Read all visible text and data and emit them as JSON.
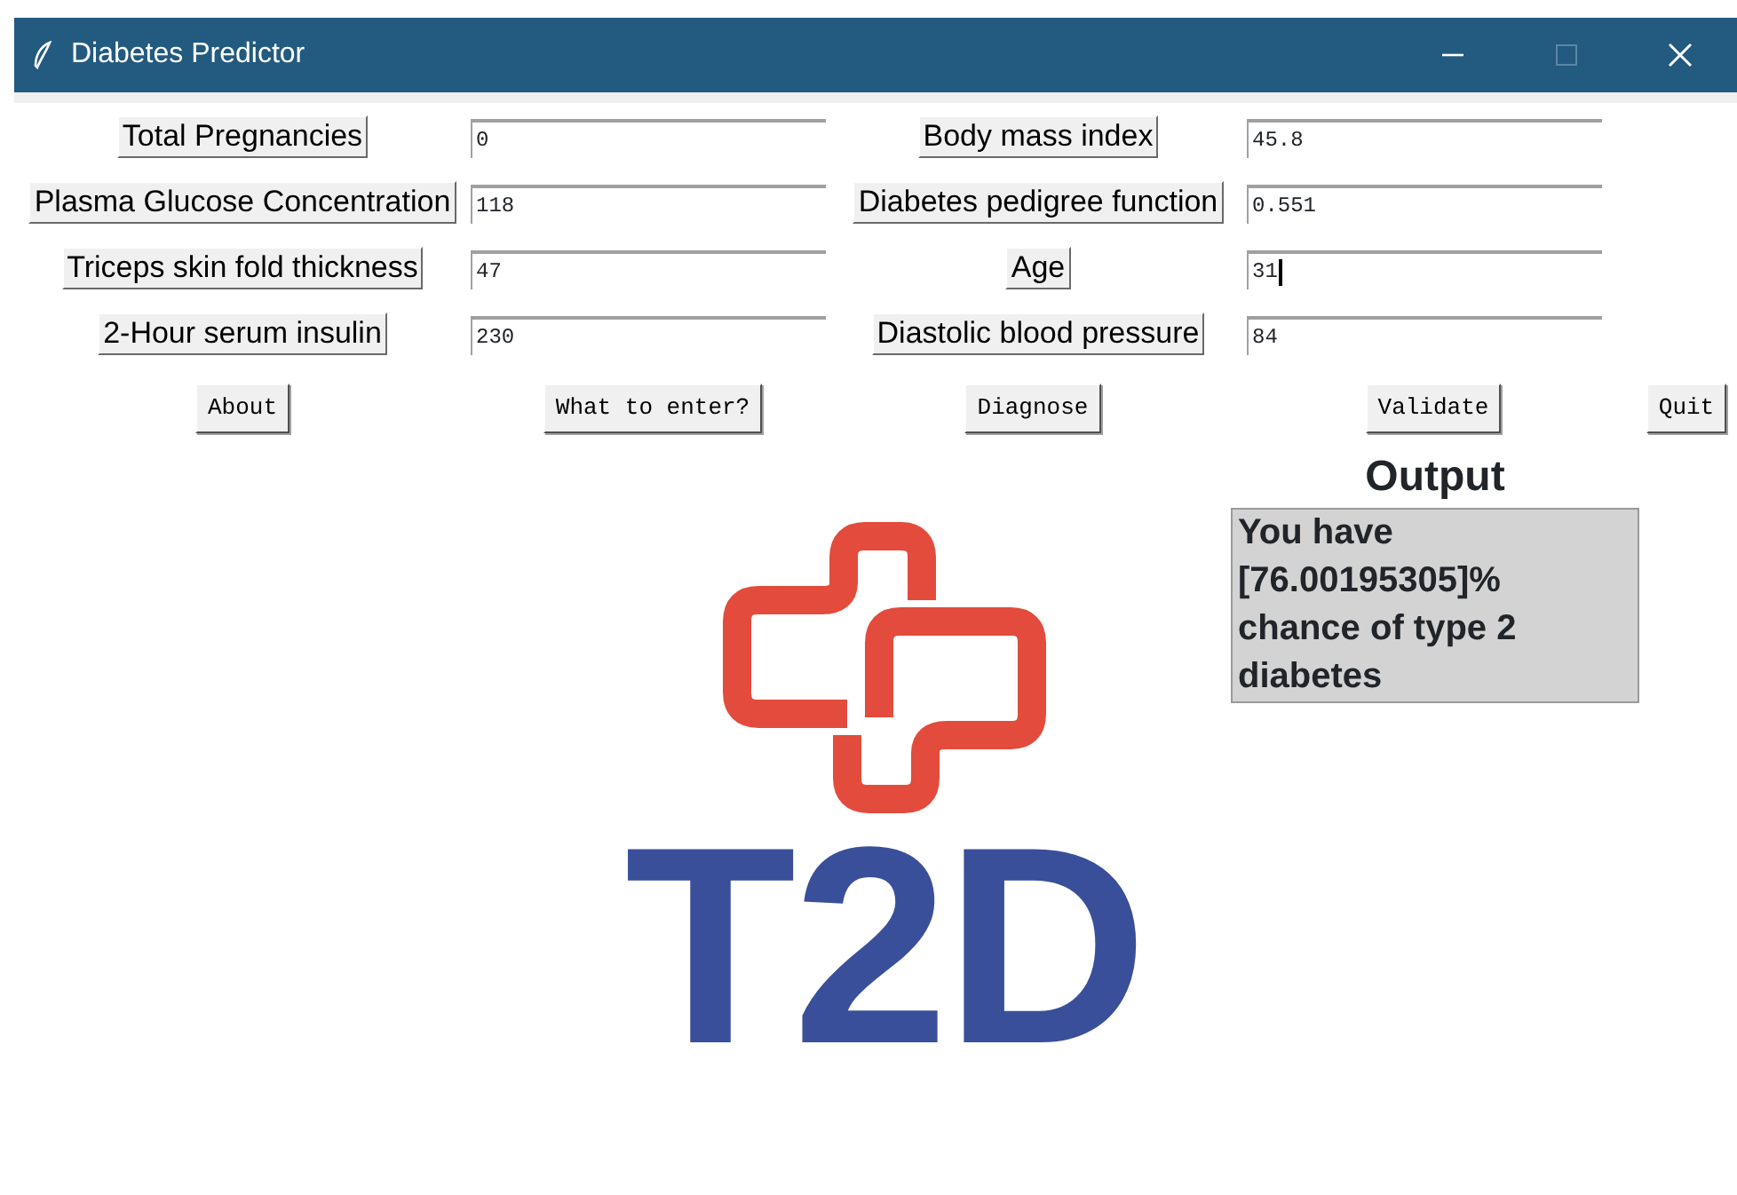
{
  "window": {
    "title": "Diabetes Predictor"
  },
  "fields": [
    {
      "label": "Total Pregnancies",
      "value": "0",
      "focused": false
    },
    {
      "label": "Body mass index",
      "value": "45.8",
      "focused": false
    },
    {
      "label": "Plasma Glucose Concentration",
      "value": "118",
      "focused": false
    },
    {
      "label": "Diabetes pedigree function",
      "value": "0.551",
      "focused": false
    },
    {
      "label": "Triceps skin fold thickness",
      "value": "47",
      "focused": false
    },
    {
      "label": "Age",
      "value": "31",
      "focused": true
    },
    {
      "label": "2-Hour serum insulin",
      "value": "230",
      "focused": false
    },
    {
      "label": "Diastolic blood pressure",
      "value": "84",
      "focused": false
    }
  ],
  "buttons": [
    "About",
    "What to enter?",
    "Diagnose",
    "Validate",
    "Quit"
  ],
  "logo": {
    "text": "T2D"
  },
  "output": {
    "heading": "Output",
    "text": "You have [76.00195305]% chance of type 2 diabetes"
  }
}
